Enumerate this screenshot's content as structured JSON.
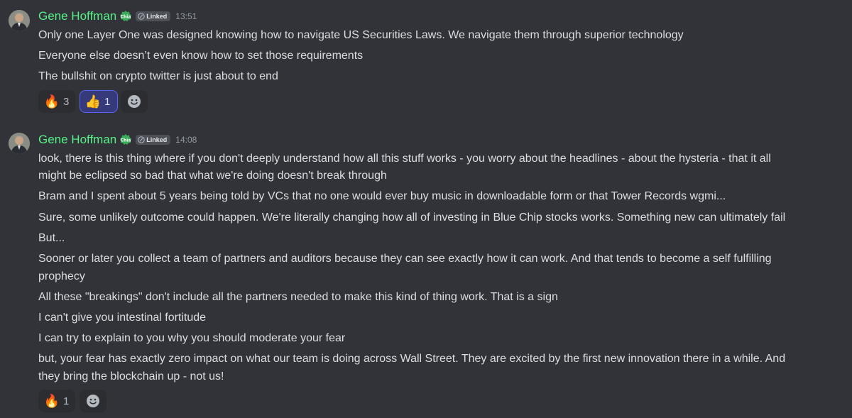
{
  "messages": [
    {
      "author": "Gene Hoffman",
      "linked_label": "Linked",
      "timestamp": "13:51",
      "lines": [
        "Only one Layer One was designed knowing how to navigate US Securities Laws. We navigate them through superior technology",
        "Everyone else doesn’t even know how to set those requirements",
        "The bullshit on crypto twitter is just about to end"
      ],
      "reactions": [
        {
          "emoji": "🔥",
          "count": "3",
          "selected": false
        },
        {
          "emoji": "👍",
          "count": "1",
          "selected": true
        }
      ]
    },
    {
      "author": "Gene Hoffman",
      "linked_label": "Linked",
      "timestamp": "14:08",
      "lines": [
        "look, there is this thing where if you don't deeply understand how all this stuff works - you worry about the headlines - about the hysteria - that it all",
        "might be eclipsed so bad that what we're doing doesn't break through",
        "Bram and I spent about 5 years being told by VCs that no one would ever buy music in downloadable form or that Tower Records wgmi...",
        "Sure, some unlikely outcome could happen. We're literally changing how all of investing in Blue Chip stocks works. Something new can ultimately fail",
        "But...",
        "Sooner or later you collect a team of partners and auditors because they can see exactly how it can work. And that tends to become a self fulfilling",
        "prophecy",
        "All these \"breakings\" don't include all the partners needed to make this kind of thing work. That is a sign",
        "I can't give you intestinal fortitude",
        "I can try to explain to you why you should moderate your fear",
        "but, your fear has exactly zero impact on what our team is doing across Wall Street. They are excited by the first new innovation there in a while. And",
        "they bring the blockchain up - not us!"
      ],
      "reactions": [
        {
          "emoji": "🔥",
          "count": "1",
          "selected": false
        }
      ]
    }
  ],
  "icons": {
    "avatar": "avatar-photo",
    "role_badge": "chia-badge-icon",
    "linked": "link-icon",
    "add_reaction": "add-reaction-smiley-icon"
  },
  "colors": {
    "background": "#313338",
    "author": "#57f287",
    "text": "#dbdee1",
    "timestamp": "#949ba4",
    "reaction_bg": "#2b2d31",
    "reaction_selected_bg": "#373a7a",
    "reaction_selected_border": "#5865f2"
  }
}
